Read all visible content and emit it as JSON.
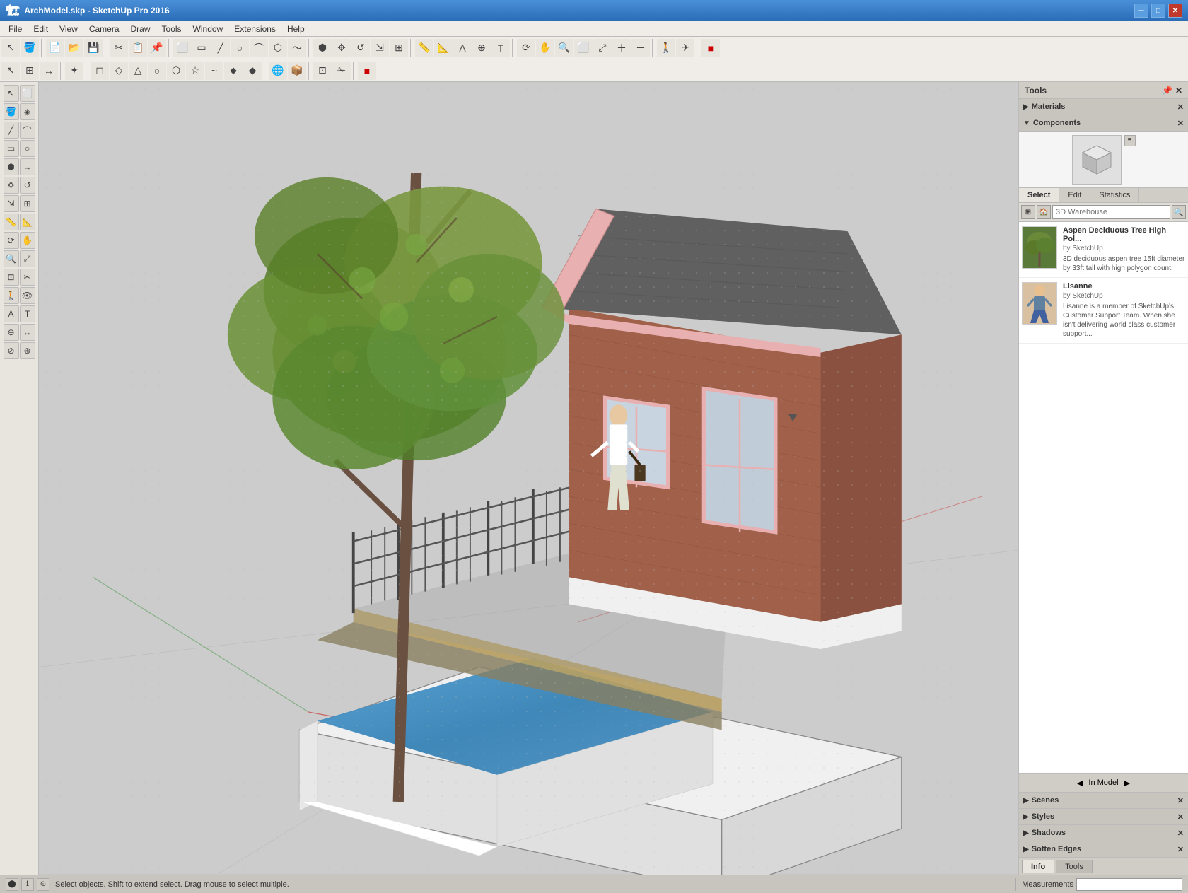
{
  "titleBar": {
    "title": "ArchModel.skp - SketchUp Pro 2016",
    "minLabel": "─",
    "maxLabel": "□",
    "closeLabel": "✕"
  },
  "menuBar": {
    "items": [
      "File",
      "Edit",
      "View",
      "Camera",
      "Draw",
      "Tools",
      "Window",
      "Extensions",
      "Help"
    ]
  },
  "toolbar1": {
    "buttons": [
      "📁",
      "💾",
      "🖨",
      "↩",
      "↪",
      "✂",
      "📋",
      "🔍",
      "⬜",
      "🏠",
      "📦",
      "⬡",
      "⬢",
      "📄",
      "🏗"
    ]
  },
  "toolbar2": {
    "buttons": [
      "↖",
      "✥",
      "⟳",
      "↗",
      "◈",
      "➡",
      "⬅"
    ]
  },
  "tools": {
    "header": "Tools",
    "pinLabel": "📌",
    "closeLabel": "✕"
  },
  "materialsSection": {
    "label": "Materials",
    "closeLabel": "✕"
  },
  "componentsSection": {
    "label": "Components",
    "closeLabel": "✕"
  },
  "componentsTabs": {
    "select": "Select",
    "edit": "Edit",
    "statistics": "Statistics"
  },
  "searchBar": {
    "placeholder": "3D Warehouse",
    "searchIcon": "🔍",
    "optionsIcon": "▼"
  },
  "components": [
    {
      "name": "Aspen Deciduous Tree High Pol...",
      "author": "by SketchUp",
      "description": "3D deciduous aspen tree 15ft diameter by 33ft tall with high polygon count.",
      "thumbColor": "#6a8a4a"
    },
    {
      "name": "Lisanne",
      "author": "by SketchUp",
      "description": "Lisanne is a member of SketchUp's Customer Support Team. When she isn't delivering world class customer support...",
      "thumbColor": "#c8a87a"
    }
  ],
  "inModelBar": {
    "leftArrow": "◀",
    "label": "In Model",
    "rightArrow": "▶"
  },
  "lowerPanels": [
    {
      "label": "Scenes",
      "closeLabel": "✕"
    },
    {
      "label": "Styles",
      "closeLabel": "✕"
    },
    {
      "label": "Shadows",
      "closeLabel": "✕"
    },
    {
      "label": "Soften Edges",
      "closeLabel": "✕"
    }
  ],
  "bottomTabs": {
    "info": "Info",
    "tools": "Tools"
  },
  "statusBar": {
    "icons": [
      "⬤",
      "ℹ",
      "⊙"
    ],
    "text": "Select objects. Shift to extend select. Drag mouse to select multiple.",
    "measurements": "Measurements"
  },
  "scene": {
    "description": "3D SketchUp scene with house, tree, pool"
  }
}
